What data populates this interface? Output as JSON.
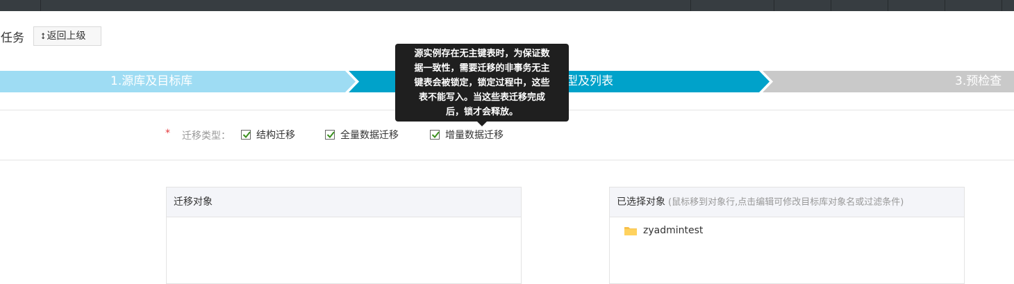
{
  "header": {
    "title_fragment": "务任务",
    "back_button": "返回上级"
  },
  "steps": [
    {
      "label": "1.源库及目标库",
      "state": "done",
      "color": "#9edcf3"
    },
    {
      "label": "型及列表",
      "state": "active",
      "color": "#00a2ca"
    },
    {
      "label": "3.预检查",
      "state": "pending",
      "color": "#c9c9c9"
    }
  ],
  "tooltip": {
    "text": "源实例存在无主键表时，为保证数据一致性，需要迁移的非事务无主键表会被锁定，锁定过程中，这些表不能写入。当这些表迁移完成后，锁才会释放。",
    "lines": [
      "源实例存在无主键表时，为保证数",
      "据一致性，需要迁移的非事务无主",
      "键表会被锁定，锁定过程中，这些",
      "表不能写入。当这些表迁移完成",
      "后，锁才会释放。"
    ]
  },
  "migration_type": {
    "required_mark": "*",
    "label": "迁移类型：",
    "options": [
      {
        "label": "结构迁移",
        "checked": true
      },
      {
        "label": "全量数据迁移",
        "checked": true
      },
      {
        "label": "增量数据迁移",
        "checked": true
      }
    ]
  },
  "source_panel": {
    "title": "迁移对象"
  },
  "selected_panel": {
    "title": "已选择对象",
    "hint": "(鼠标移到对象行,点击编辑可修改目标库对象名或过滤条件)",
    "items": [
      "zyadmintest"
    ]
  },
  "colors": {
    "topbar": "#373d41",
    "check": "#3a8f1e",
    "folder": "#f7c04a"
  }
}
